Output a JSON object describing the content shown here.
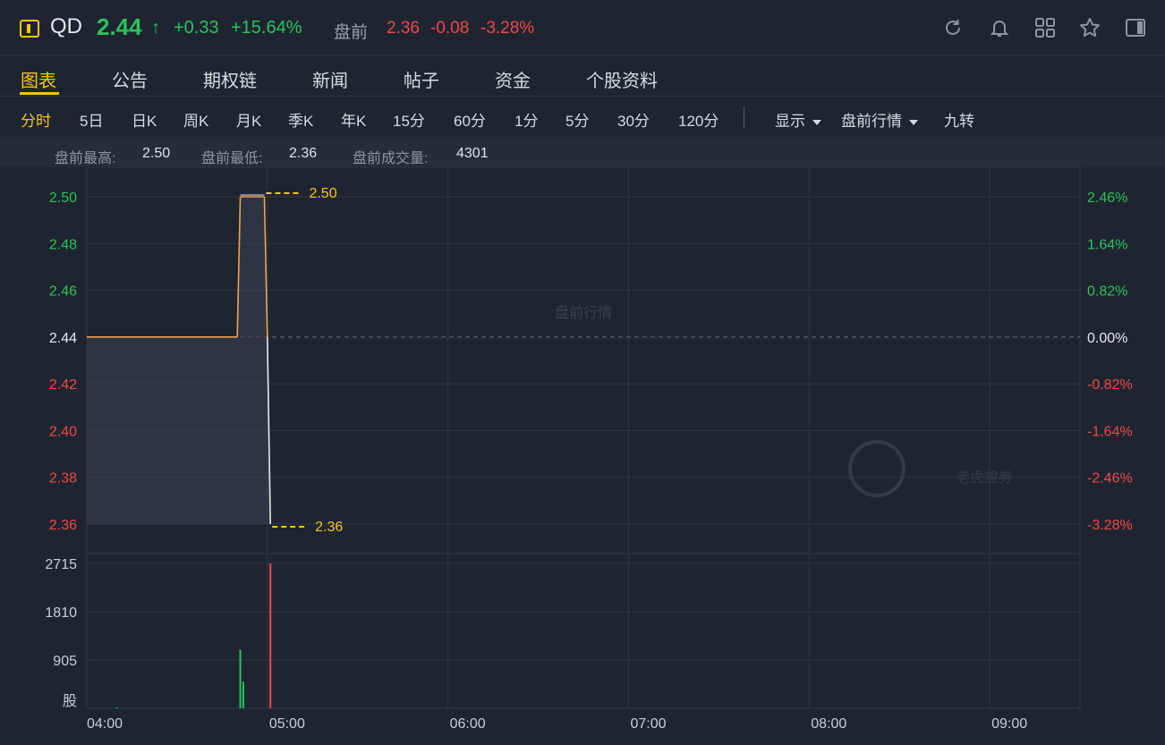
{
  "header": {
    "symbol": "QD",
    "last_price": "2.44",
    "arrow": "↑",
    "change": "+0.33",
    "change_pct": "+15.64%",
    "pre_label": "盘前",
    "pre_price": "2.36",
    "pre_change": "-0.08",
    "pre_change_pct": "-3.28%",
    "icons": [
      "refresh-icon",
      "bell-icon",
      "grid-icon",
      "star-icon",
      "panel-icon"
    ]
  },
  "tabs": [
    {
      "label": "图表",
      "active": true
    },
    {
      "label": "公告"
    },
    {
      "label": "期权链"
    },
    {
      "label": "新闻"
    },
    {
      "label": "帖子"
    },
    {
      "label": "资金"
    },
    {
      "label": "个股资料"
    }
  ],
  "periods": {
    "items": [
      {
        "label": "分时",
        "active": true
      },
      {
        "label": "5日"
      },
      {
        "label": "日K"
      },
      {
        "label": "周K"
      },
      {
        "label": "月K"
      },
      {
        "label": "季K"
      },
      {
        "label": "年K"
      },
      {
        "label": "15分"
      },
      {
        "label": "60分"
      },
      {
        "label": "1分"
      },
      {
        "label": "5分"
      },
      {
        "label": "30分"
      },
      {
        "label": "120分"
      }
    ],
    "display_dropdown": "显示",
    "session_dropdown": "盘前行情",
    "nine_turn": "九转"
  },
  "stats": {
    "high_label": "盘前最高:",
    "high_value": "2.50",
    "low_label": "盘前最低:",
    "low_value": "2.36",
    "volume_label": "盘前成交量:",
    "volume_value": "4301"
  },
  "chart_data": {
    "type": "line",
    "watermark": "盘前行情",
    "brand_watermark": "老虎證券",
    "price_ticks": [
      "2.50",
      "2.48",
      "2.46",
      "2.44",
      "2.42",
      "2.40",
      "2.38",
      "2.36"
    ],
    "price_tick_values": [
      2.5,
      2.48,
      2.46,
      2.44,
      2.42,
      2.4,
      2.38,
      2.36
    ],
    "pct_ticks": [
      "2.46%",
      "1.64%",
      "0.82%",
      "0.00%",
      "-0.82%",
      "-1.64%",
      "-2.46%",
      "-3.28%"
    ],
    "ylim": [
      2.36,
      2.5
    ],
    "base_price": 2.44,
    "time_ticks": [
      "04:00",
      "05:00",
      "06:00",
      "07:00",
      "08:00",
      "09:00"
    ],
    "series": [
      {
        "x_minutes": [
          0,
          50,
          51,
          59,
          60,
          61
        ],
        "values": [
          2.44,
          2.44,
          2.5,
          2.5,
          2.44,
          2.36
        ]
      }
    ],
    "high_marker": "2.50",
    "low_marker": "2.36",
    "volume_ticks": [
      "2715",
      "1810",
      "905"
    ],
    "volume_unit": "股",
    "volume_max": 2715,
    "volume_bars": [
      {
        "minute": 10,
        "value": 20,
        "color": "#29c35c"
      },
      {
        "minute": 51,
        "value": 1100,
        "color": "#29c35c"
      },
      {
        "minute": 52,
        "value": 500,
        "color": "#29c35c"
      },
      {
        "minute": 61,
        "value": 2715,
        "color": "#f04848"
      }
    ],
    "colors": {
      "up": "#29c35c",
      "down": "#f04848",
      "neutral": "#e6e9ee",
      "price_line": "#f0a050",
      "marker": "#f5c518"
    }
  }
}
